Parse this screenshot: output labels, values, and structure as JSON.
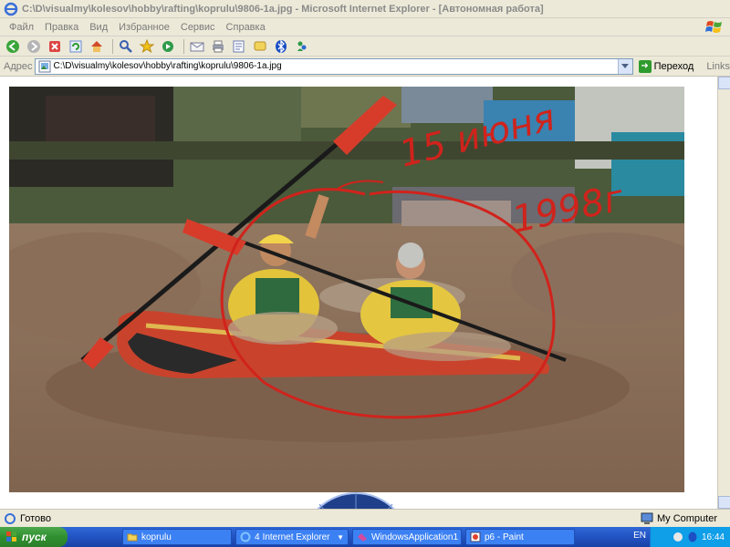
{
  "window": {
    "title": "C:\\D\\visualmy\\kolesov\\hobby\\rafting\\koprulu\\9806-1a.jpg - Microsoft Internet Explorer - [Автономная работа]"
  },
  "menu": [
    "Файл",
    "Правка",
    "Вид",
    "Избранное",
    "Сервис",
    "Справка"
  ],
  "toolbar": {
    "icons": [
      "back-icon",
      "forward-icon",
      "stop-icon",
      "refresh-icon",
      "home-icon",
      "search-icon",
      "favorites-icon",
      "media-icon",
      "mail-icon",
      "print-icon",
      "edit-icon",
      "discuss-icon",
      "bluetooth-icon",
      "messenger-icon"
    ]
  },
  "address": {
    "label": "Адрес",
    "value": "C:\\D\\visualmy\\kolesov\\hobby\\rafting\\koprulu\\9806-1a.jpg",
    "go_label": "Переход",
    "links_label": "Links"
  },
  "photo": {
    "handwritten_line1": "15 июня",
    "handwritten_line2": "1998г",
    "annotation_color": "#d0231c"
  },
  "status": {
    "text": "Готово",
    "zone": "My Computer"
  },
  "taskbar": {
    "start_label": "пуск",
    "tasks": [
      {
        "label": "koprulu",
        "icon": "folder-icon"
      },
      {
        "label": "Internet Explorer",
        "count": "4",
        "icon": "ie-icon"
      },
      {
        "label": "WindowsApplication1 ...",
        "icon": "vs-icon"
      },
      {
        "label": "p6 - Paint",
        "icon": "paint-icon"
      }
    ],
    "language": "EN",
    "clock": "16:44"
  }
}
